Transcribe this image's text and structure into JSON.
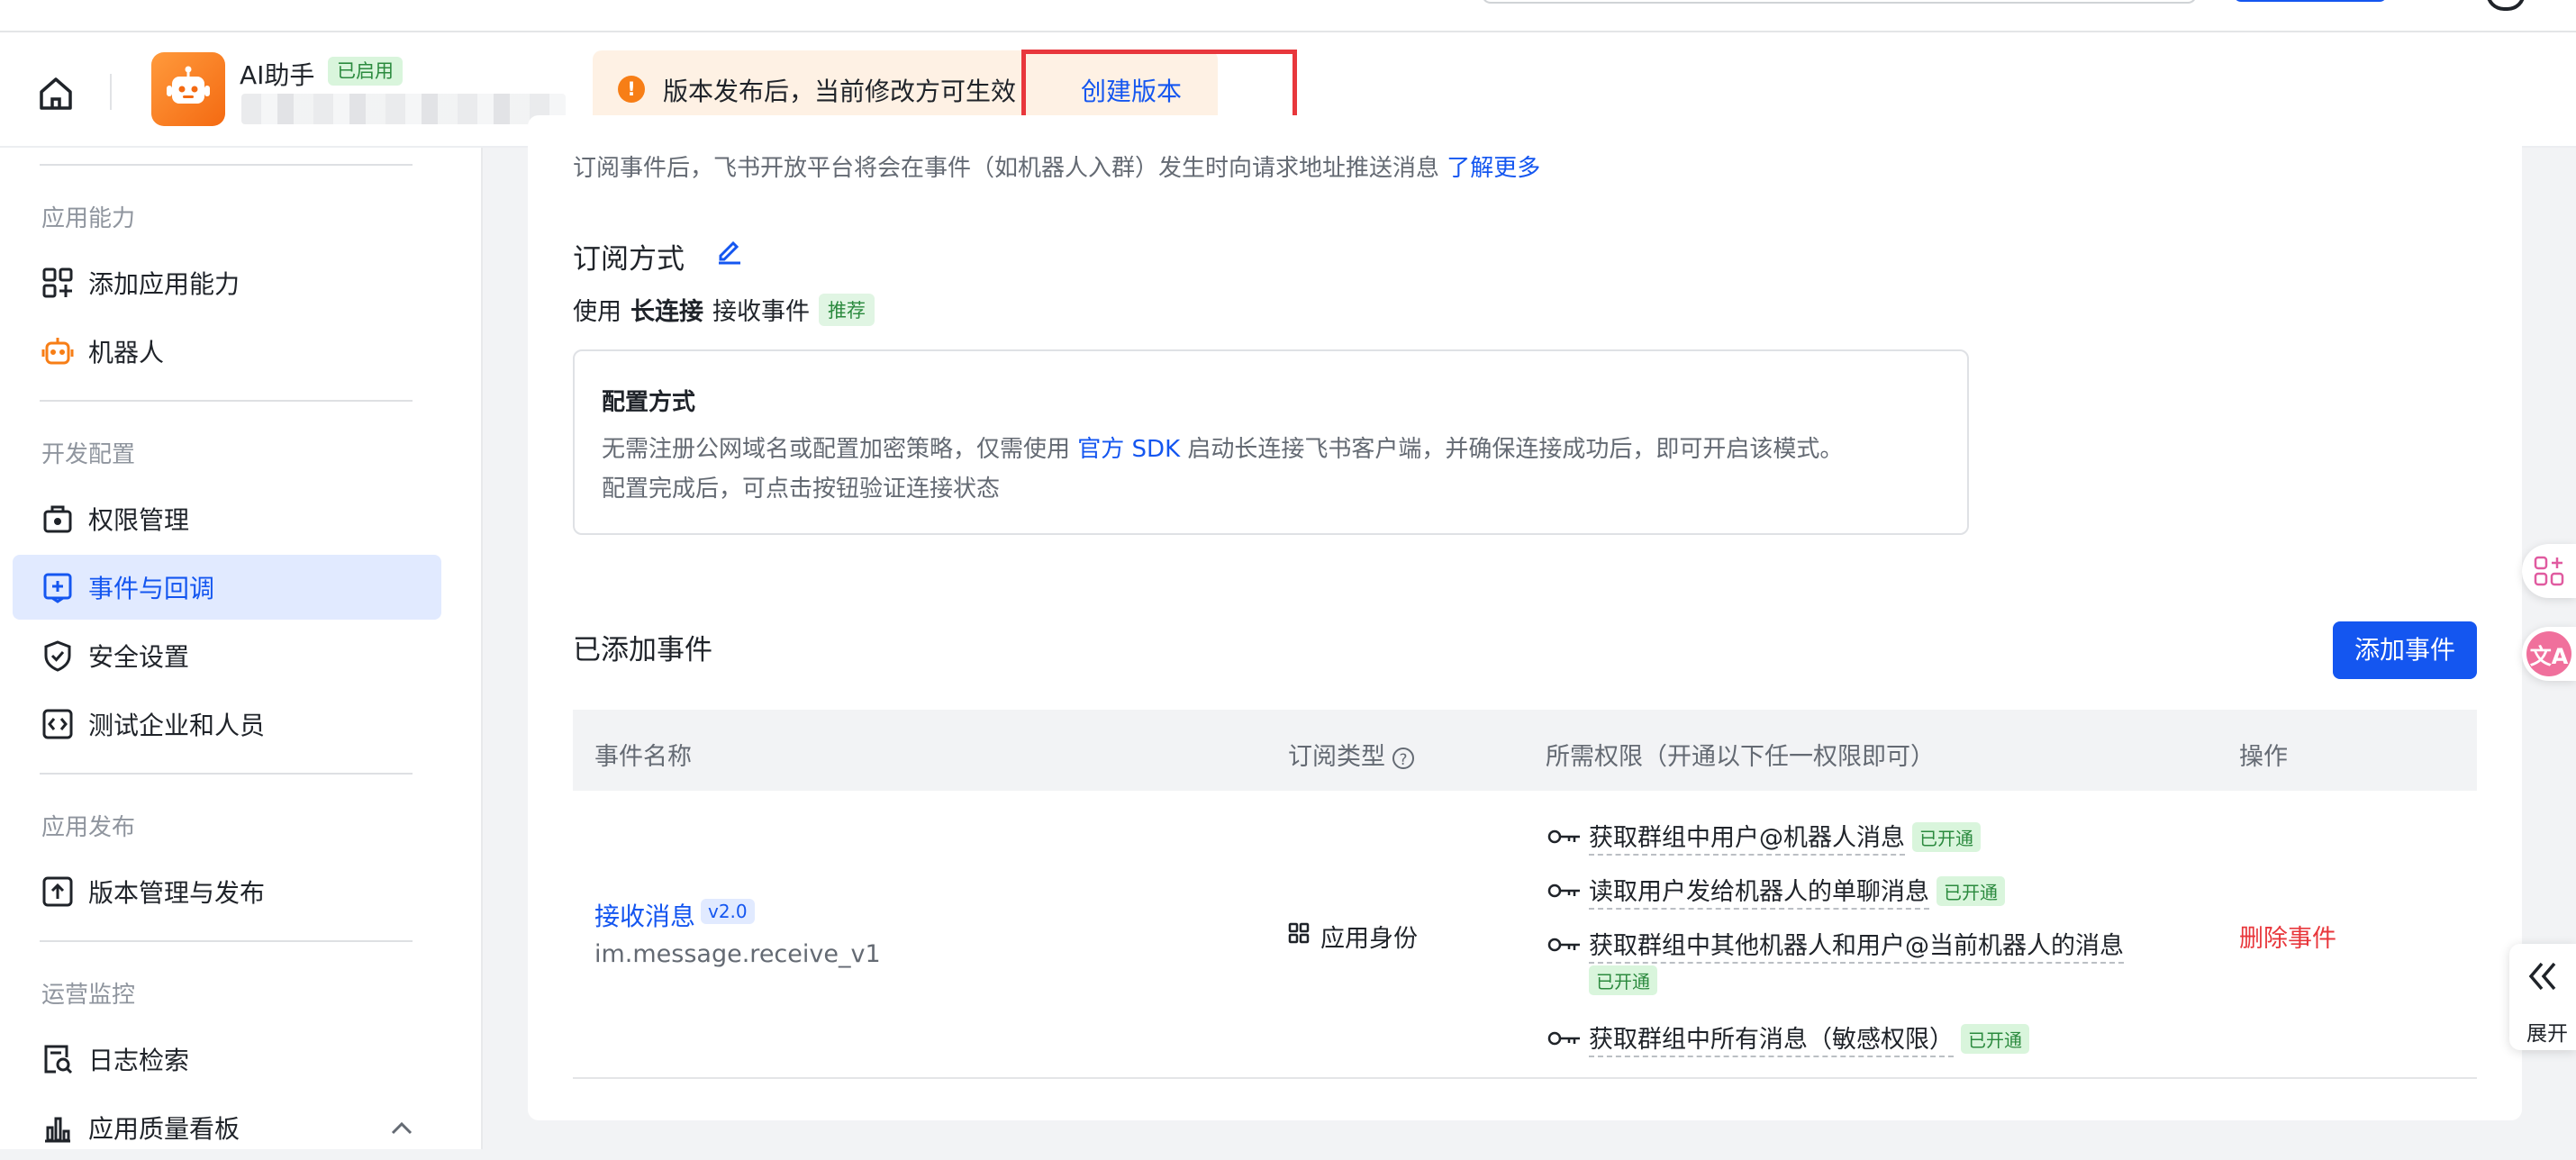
{
  "header": {
    "app_name": "AI助手",
    "app_status": "已启用",
    "notice_text": "版本发布后，当前修改方可生效",
    "create_version": "创建版本"
  },
  "sidebar": {
    "sections": [
      "应用能力",
      "开发配置",
      "应用发布",
      "运营监控"
    ],
    "items": [
      {
        "label": "添加应用能力",
        "icon": "add-capability-icon"
      },
      {
        "label": "机器人",
        "icon": "robot-icon"
      },
      {
        "label": "权限管理",
        "icon": "permission-icon"
      },
      {
        "label": "事件与回调",
        "icon": "event-callback-icon",
        "active": true
      },
      {
        "label": "安全设置",
        "icon": "shield-icon"
      },
      {
        "label": "测试企业和人员",
        "icon": "code-icon"
      },
      {
        "label": "版本管理与发布",
        "icon": "upload-icon"
      },
      {
        "label": "日志检索",
        "icon": "log-search-icon"
      },
      {
        "label": "应用质量看板",
        "icon": "bar-chart-icon"
      }
    ]
  },
  "main": {
    "desc_text": "订阅事件后，飞书开放平台将会在事件（如机器人入群）发生时向请求地址推送消息",
    "learn_more": "了解更多",
    "sub_method_title": "订阅方式",
    "use_prefix": "使用",
    "use_bold": "长连接",
    "use_suffix": "接收事件",
    "recommend_tag": "推荐",
    "config": {
      "title": "配置方式",
      "line1_a": "无需注册公网域名或配置加密策略，仅需使用",
      "line1_link": "官方 SDK",
      "line1_b": "启动长连接飞书客户端，并确保连接成功后，即可开启该模式。",
      "line2": "配置完成后，可点击按钮验证连接状态"
    },
    "added_title": "已添加事件",
    "add_button": "添加事件",
    "table": {
      "headers": [
        "事件名称",
        "订阅类型",
        "所需权限（开通以下任一权限即可）",
        "操作"
      ],
      "row": {
        "event_name": "接收消息",
        "version": "v2.0",
        "event_id": "im.message.receive_v1",
        "sub_type": "应用身份",
        "permissions": [
          {
            "text": "获取群组中用户@机器人消息",
            "status": "已开通"
          },
          {
            "text": "读取用户发给机器人的单聊消息",
            "status": "已开通"
          },
          {
            "text": "获取群组中其他机器人和用户@当前机器人的消息",
            "status": "已开通"
          },
          {
            "text": "获取群组中所有消息（敏感权限）",
            "status": "已开通"
          }
        ],
        "action": "删除事件"
      }
    }
  },
  "right_panel": {
    "expand_label": "展开"
  },
  "colors": {
    "primary": "#1456f0",
    "danger": "#e8373c",
    "success_bg": "#d9f5dc",
    "notice_bg": "#fef1e4",
    "app_icon": "#f77e16"
  }
}
